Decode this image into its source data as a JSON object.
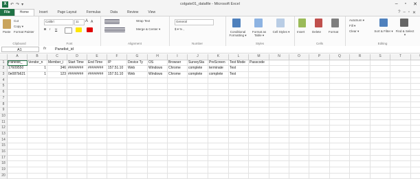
{
  "window": {
    "title": "colgate01_datafile - Microsoft Excel",
    "qat": [
      "↶",
      "↷",
      "▾"
    ],
    "controls": [
      "–",
      "▫",
      "✕"
    ]
  },
  "tabs": [
    "File",
    "Home",
    "Insert",
    "Page Layout",
    "Formulas",
    "Data",
    "Review",
    "View"
  ],
  "tab_right": [
    "?",
    "–",
    "▫",
    "✕"
  ],
  "ribbon": {
    "clipboard": {
      "cut": "Cut",
      "copy": "Copy ▾",
      "paste": "Paste",
      "format_painter": "Format Painter",
      "label": "Clipboard"
    },
    "font": {
      "name": "Calibri",
      "size": "11",
      "grow": "A",
      "shrink": "A",
      "label": "Font"
    },
    "alignment": {
      "wrap": "Wrap Text",
      "merge": "Merge & Center ▾",
      "label": "Alignment"
    },
    "number": {
      "format": "General",
      "symbols": "$ ▾ % ,",
      "label": "Number"
    },
    "styles": {
      "conditional": "Conditional Formatting ▾",
      "as_table": "Format as Table ▾",
      "cell_styles": "Cell Styles ▾",
      "label": "Styles"
    },
    "cells": {
      "insert": "Insert",
      "delete": "Delete",
      "format": "Format",
      "label": "Cells"
    },
    "editing": {
      "autosum": "AutoSum ▾",
      "fill": "Fill ▾",
      "clear": "Clear ▾",
      "sort": "Sort & Filter ▾",
      "find": "Find & Select ▾",
      "label": "Editing"
    }
  },
  "formula_bar": {
    "name_box": "A1",
    "fx": "fx",
    "value": "Panelist_id"
  },
  "columns": [
    "A",
    "B",
    "C",
    "D",
    "E",
    "F",
    "G",
    "H",
    "I",
    "J",
    "K",
    "L",
    "M",
    "N",
    "O",
    "P",
    "Q",
    "R",
    "S",
    "T",
    "U"
  ],
  "rows": [
    [
      "Panelist_",
      "Vendor_n",
      "Member_i",
      "Start Time",
      "End Time",
      "IP",
      "Device Ty",
      "OS",
      "Browser",
      "SurveySta",
      "PreScreen",
      "Test Mode",
      "Passcode",
      "",
      "",
      "",
      "",
      "",
      "",
      "",
      ""
    ],
    [
      "17609550",
      "1",
      "346",
      "########",
      "########",
      "157.51.10",
      "Web",
      "Windows",
      "Chrome",
      "complete",
      "terminate",
      "Test",
      "",
      "",
      "",
      "",
      "",
      "",
      "",
      "",
      ""
    ],
    [
      "0e087b621",
      "1",
      "123",
      "########",
      "########",
      "157.51.10",
      "Web",
      "Windows",
      "Chrome",
      "complete",
      "complete",
      "Test",
      "",
      "",
      "",
      "",
      "",
      "",
      "",
      "",
      ""
    ],
    [
      "",
      "",
      "",
      "",
      "",
      "",
      "",
      "",
      "",
      "",
      "",
      "",
      "",
      "",
      "",
      "",
      "",
      "",
      "",
      "",
      ""
    ],
    [
      "",
      "",
      "",
      "",
      "",
      "",
      "",
      "",
      "",
      "",
      "",
      "",
      "",
      "",
      "",
      "",
      "",
      "",
      "",
      "",
      ""
    ],
    [
      "",
      "",
      "",
      "",
      "",
      "",
      "",
      "",
      "",
      "",
      "",
      "",
      "",
      "",
      "",
      "",
      "",
      "",
      "",
      "",
      ""
    ],
    [
      "",
      "",
      "",
      "",
      "",
      "",
      "",
      "",
      "",
      "",
      "",
      "",
      "",
      "",
      "",
      "",
      "",
      "",
      "",
      "",
      ""
    ],
    [
      "",
      "",
      "",
      "",
      "",
      "",
      "",
      "",
      "",
      "",
      "",
      "",
      "",
      "",
      "",
      "",
      "",
      "",
      "",
      "",
      ""
    ],
    [
      "",
      "",
      "",
      "",
      "",
      "",
      "",
      "",
      "",
      "",
      "",
      "",
      "",
      "",
      "",
      "",
      "",
      "",
      "",
      "",
      ""
    ],
    [
      "",
      "",
      "",
      "",
      "",
      "",
      "",
      "",
      "",
      "",
      "",
      "",
      "",
      "",
      "",
      "",
      "",
      "",
      "",
      "",
      ""
    ],
    [
      "",
      "",
      "",
      "",
      "",
      "",
      "",
      "",
      "",
      "",
      "",
      "",
      "",
      "",
      "",
      "",
      "",
      "",
      "",
      "",
      ""
    ],
    [
      "",
      "",
      "",
      "",
      "",
      "",
      "",
      "",
      "",
      "",
      "",
      "",
      "",
      "",
      "",
      "",
      "",
      "",
      "",
      "",
      ""
    ],
    [
      "",
      "",
      "",
      "",
      "",
      "",
      "",
      "",
      "",
      "",
      "",
      "",
      "",
      "",
      "",
      "",
      "",
      "",
      "",
      "",
      ""
    ],
    [
      "",
      "",
      "",
      "",
      "",
      "",
      "",
      "",
      "",
      "",
      "",
      "",
      "",
      "",
      "",
      "",
      "",
      "",
      "",
      "",
      ""
    ],
    [
      "",
      "",
      "",
      "",
      "",
      "",
      "",
      "",
      "",
      "",
      "",
      "",
      "",
      "",
      "",
      "",
      "",
      "",
      "",
      "",
      ""
    ],
    [
      "",
      "",
      "",
      "",
      "",
      "",
      "",
      "",
      "",
      "",
      "",
      "",
      "",
      "",
      "",
      "",
      "",
      "",
      "",
      "",
      ""
    ],
    [
      "",
      "",
      "",
      "",
      "",
      "",
      "",
      "",
      "",
      "",
      "",
      "",
      "",
      "",
      "",
      "",
      "",
      "",
      "",
      "",
      ""
    ],
    [
      "",
      "",
      "",
      "",
      "",
      "",
      "",
      "",
      "",
      "",
      "",
      "",
      "",
      "",
      "",
      "",
      "",
      "",
      "",
      "",
      ""
    ],
    [
      "",
      "",
      "",
      "",
      "",
      "",
      "",
      "",
      "",
      "",
      "",
      "",
      "",
      "",
      "",
      "",
      "",
      "",
      "",
      "",
      ""
    ],
    [
      "",
      "",
      "",
      "",
      "",
      "",
      "",
      "",
      "",
      "",
      "",
      "",
      "",
      "",
      "",
      "",
      "",
      "",
      "",
      "",
      ""
    ]
  ],
  "numeric_cols": [
    1,
    2
  ],
  "colors": {
    "accent": "#217346",
    "selection": "#217346"
  }
}
